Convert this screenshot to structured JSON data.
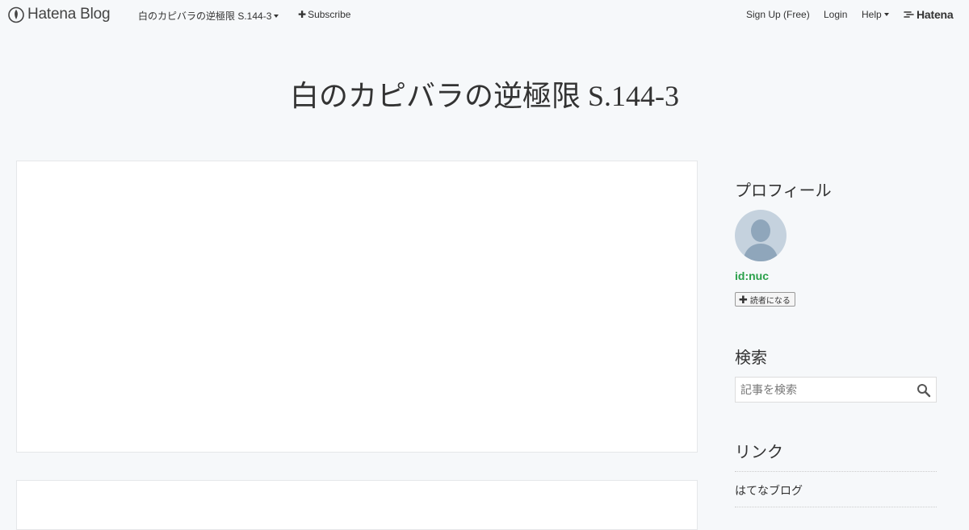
{
  "global_header": {
    "logo_text": "Hatena Blog",
    "blog_name": "白のカピバラの逆極限 S.144-3",
    "subscribe_label": "Subscribe",
    "signup_label": "Sign Up (Free)",
    "login_label": "Login",
    "help_label": "Help",
    "hatena_label": "Hatena"
  },
  "blog": {
    "title": "白のカピバラの逆極限 S.144-3"
  },
  "sidebar": {
    "profile": {
      "title": "プロフィール",
      "user_id": "id:nuc",
      "follow_label": "読者になる"
    },
    "search": {
      "title": "検索",
      "placeholder": "記事を検索"
    },
    "links": {
      "title": "リンク",
      "items": [
        {
          "label": "はてなブログ"
        }
      ]
    }
  },
  "colors": {
    "background": "#f6f8fa",
    "user_id": "#2aa04a",
    "avatar": "#c5d2de"
  }
}
